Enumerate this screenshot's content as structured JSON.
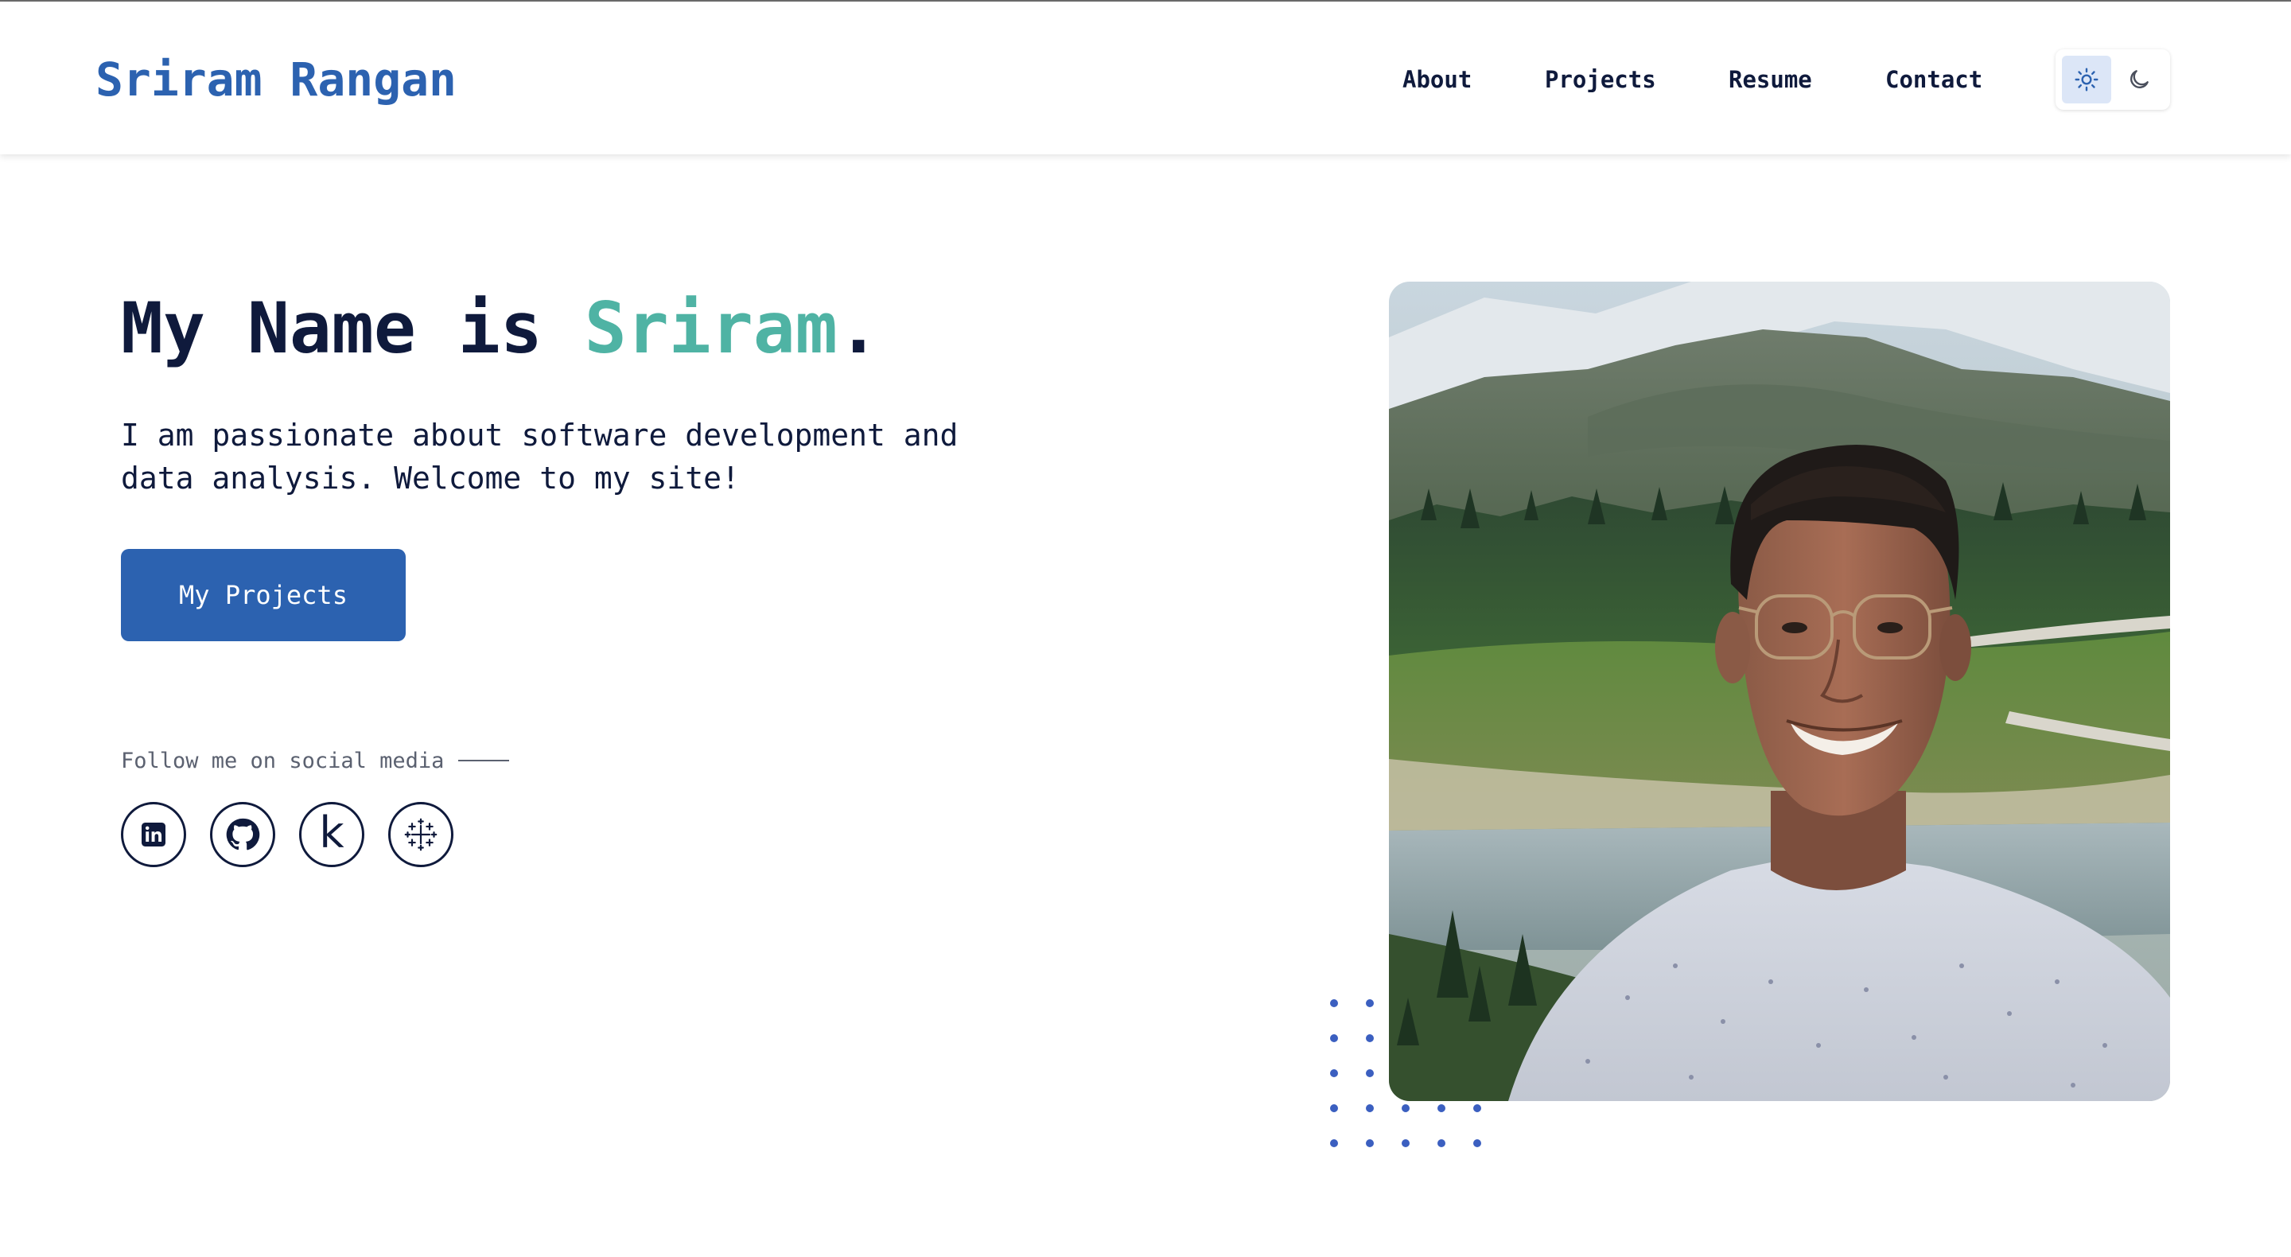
{
  "header": {
    "brand": "Sriram Rangan",
    "nav": [
      {
        "label": "About"
      },
      {
        "label": "Projects"
      },
      {
        "label": "Resume"
      },
      {
        "label": "Contact"
      }
    ],
    "theme_toggle": {
      "light_icon": "sun-icon",
      "dark_icon": "moon-icon",
      "active": "light"
    }
  },
  "hero": {
    "title_prefix": "My Name is ",
    "title_name": "Sriram",
    "title_suffix": ".",
    "description": "I am passionate about software development and data analysis. Welcome to my site!",
    "cta_label": "My Projects",
    "follow_label": "Follow me on social media",
    "socials": [
      {
        "icon": "linkedin-icon"
      },
      {
        "icon": "github-icon"
      },
      {
        "icon": "kaggle-icon",
        "glyph": "k"
      },
      {
        "icon": "tableau-icon"
      }
    ]
  },
  "colors": {
    "brand": "#2c62b0",
    "accent": "#4fb3a4",
    "text": "#0f1a3c",
    "dots": "#3b5fc0"
  }
}
